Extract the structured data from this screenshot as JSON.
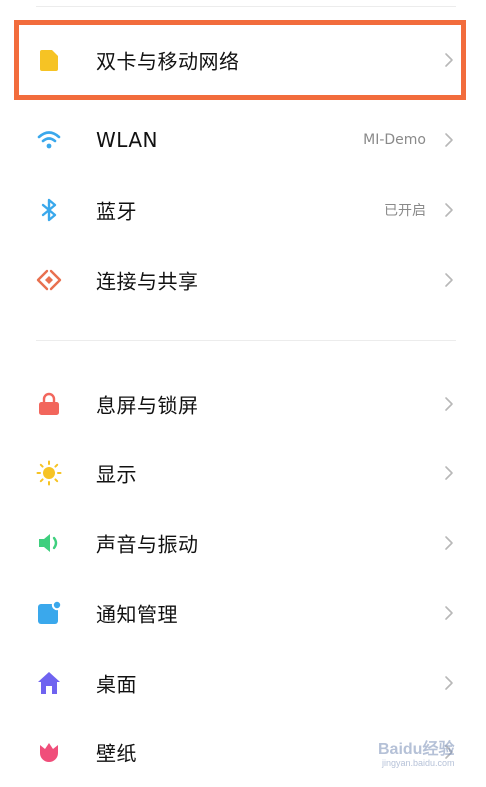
{
  "settings": {
    "group1": [
      {
        "label": "双卡与移动网络",
        "value": "",
        "icon": "sim-card-icon",
        "icon_color": "#f6c324"
      },
      {
        "label": "WLAN",
        "value": "MI-Demo",
        "icon": "wifi-icon",
        "icon_color": "#3aa8ec"
      },
      {
        "label": "蓝牙",
        "value": "已开启",
        "icon": "bluetooth-icon",
        "icon_color": "#3aa8ec"
      },
      {
        "label": "连接与共享",
        "value": "",
        "icon": "connection-sharing-icon",
        "icon_color": "#e8704f"
      }
    ],
    "group2": [
      {
        "label": "息屏与锁屏",
        "value": "",
        "icon": "lock-icon",
        "icon_color": "#f2665c"
      },
      {
        "label": "显示",
        "value": "",
        "icon": "sun-icon",
        "icon_color": "#f6c324"
      },
      {
        "label": "声音与振动",
        "value": "",
        "icon": "speaker-icon",
        "icon_color": "#3ecf7e"
      },
      {
        "label": "通知管理",
        "value": "",
        "icon": "notification-icon",
        "icon_color": "#3aa8ec"
      },
      {
        "label": "桌面",
        "value": "",
        "icon": "home-icon",
        "icon_color": "#6f63f0"
      },
      {
        "label": "壁纸",
        "value": "",
        "icon": "wallpaper-tulip-icon",
        "icon_color": "#f04e7a"
      }
    ]
  },
  "watermark": {
    "brand": "Baidu经验",
    "url": "jingyan.baidu.com"
  },
  "colors": {
    "highlight_border": "#f26c3c",
    "chevron": "#b8b8b8",
    "secondary_text": "#8a8a8a"
  }
}
